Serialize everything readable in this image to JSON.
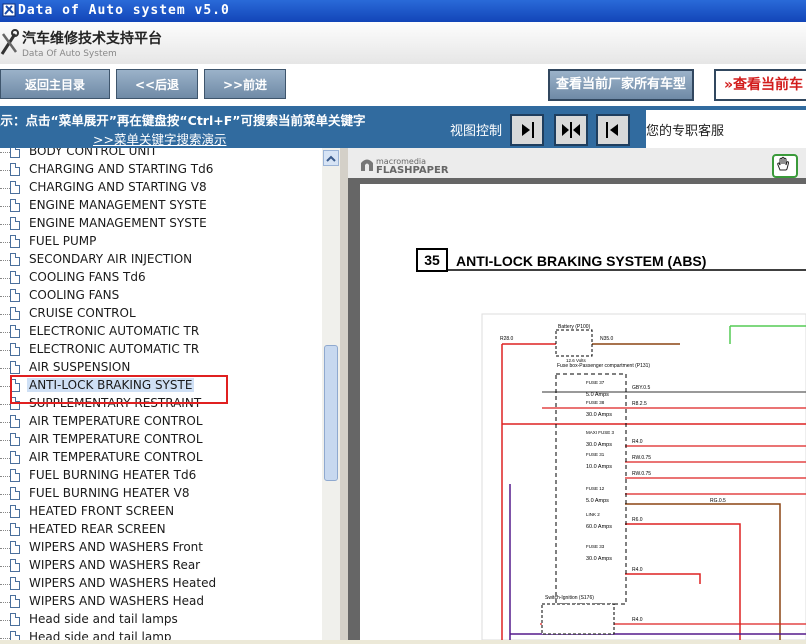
{
  "window": {
    "title": "Data of Auto system v5.0"
  },
  "header": {
    "title_cn": "汽车维修技术支持平台",
    "title_en": "Data Of Auto System"
  },
  "toolbar": {
    "home": "返回主目录",
    "back": "<<后退",
    "forward": ">>前进",
    "all_models": "查看当前厂家所有车型",
    "current_model": "查看当前车"
  },
  "infobar": {
    "hint": "提示：点击“菜单展开”再在键盘按“Ctrl+F”可搜索当前菜单关键字",
    "demo_link": ">>菜单关键字搜索演示",
    "view_control": "视图控制"
  },
  "customer_service": "您的专职客服",
  "tree": {
    "items": [
      "BODY CONTROL UNIT",
      "CHARGING AND STARTING Td6",
      "CHARGING AND STARTING V8",
      "ENGINE MANAGEMENT SYSTE",
      "ENGINE MANAGEMENT SYSTE",
      "FUEL PUMP",
      "SECONDARY AIR INJECTION",
      "COOLING FANS Td6",
      "COOLING FANS",
      "CRUISE CONTROL",
      "ELECTRONIC AUTOMATIC TR",
      "ELECTRONIC AUTOMATIC TR",
      "AIR SUSPENSION",
      "ANTI-LOCK BRAKING SYSTE",
      "SUPPLEMENTARY RESTRAINT",
      "AIR TEMPERATURE CONTROL",
      "AIR TEMPERATURE CONTROL",
      "AIR TEMPERATURE CONTROL",
      "FUEL BURNING HEATER Td6",
      "FUEL BURNING HEATER V8",
      "HEATED FRONT SCREEN",
      "HEATED REAR SCREEN",
      "WIPERS AND WASHERS Front",
      "WIPERS AND WASHERS Rear",
      "WIPERS AND WASHERS Heated",
      "WIPERS AND WASHERS Head",
      "Head side and tail lamps",
      "Head side and tail lamp"
    ],
    "selected_index": 13
  },
  "viewer": {
    "brand_top": "macromedia",
    "brand": "FLASHPAPER",
    "doc_number": "35",
    "doc_title": "ANTI-LOCK BRAKING SYSTEM (ABS)",
    "diagram": {
      "battery": "Battery (P100)",
      "battery_v": "12.6 Volts",
      "fusebox": "Fuse box-Passenger compartment (P131)",
      "switch": "Switch-Ignition (S176)",
      "wire_r28": "R28.0",
      "wire_n35": "N35.0",
      "wire_gby": "GBY.0.5",
      "wire_r25": "R8.2.5",
      "wire_r40": "R4.0",
      "wire_rw75": "RW.0.75",
      "wire_rw75b": "RW.0.75",
      "wire_rg05": "RG.0.5",
      "wire_r60": "R6.0",
      "wire_r40b": "R4.0",
      "wire_r40c": "R4.0",
      "fuse_37": "FUSE 37",
      "fuse_37a": "5.0 Amps",
      "fuse_38": "FUSE 38",
      "fuse_38a": "30.0 Amps",
      "maxi_3": "MAXI FUSE 3",
      "maxi_3a": "30.0 Amps",
      "fuse_31": "FUSE 31",
      "fuse_31a": "10.0 Amps",
      "fuse_12": "FUSE 12",
      "fuse_12a": "5.0 Amps",
      "link_2": "LINK 2",
      "link_2a": "60.0 Amps",
      "fuse_33": "FUSE 33",
      "fuse_33a": "30.0 Amps"
    }
  }
}
